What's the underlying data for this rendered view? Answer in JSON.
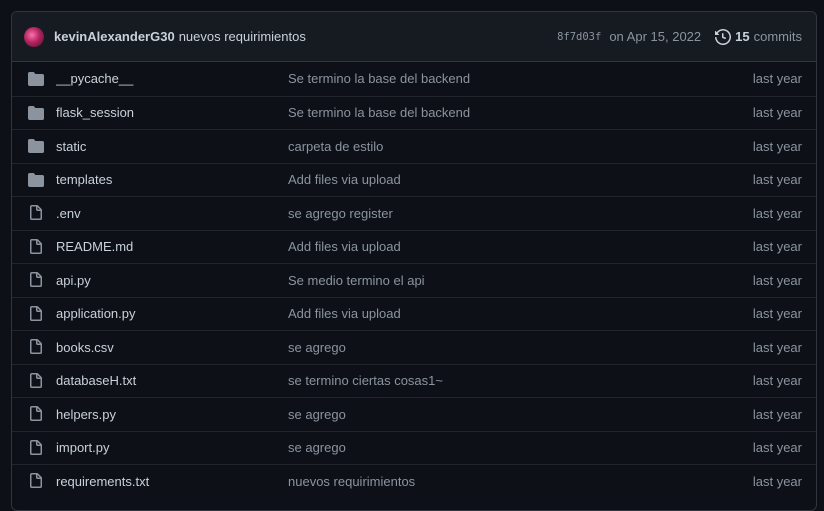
{
  "commit": {
    "author": "kevinAlexanderG30",
    "message": "nuevos requirimientos",
    "sha": "8f7d03f",
    "date": "on Apr 15, 2022",
    "count": "15",
    "count_label": "commits"
  },
  "files": [
    {
      "type": "folder",
      "name": "__pycache__",
      "message": "Se termino la base del backend",
      "age": "last year"
    },
    {
      "type": "folder",
      "name": "flask_session",
      "message": "Se termino la base del backend",
      "age": "last year"
    },
    {
      "type": "folder",
      "name": "static",
      "message": "carpeta de estilo",
      "age": "last year"
    },
    {
      "type": "folder",
      "name": "templates",
      "message": "Add files via upload",
      "age": "last year"
    },
    {
      "type": "file",
      "name": ".env",
      "message": "se agrego register",
      "age": "last year"
    },
    {
      "type": "file",
      "name": "README.md",
      "message": "Add files via upload",
      "age": "last year"
    },
    {
      "type": "file",
      "name": "api.py",
      "message": "Se medio termino el api",
      "age": "last year"
    },
    {
      "type": "file",
      "name": "application.py",
      "message": "Add files via upload",
      "age": "last year"
    },
    {
      "type": "file",
      "name": "books.csv",
      "message": "se agrego",
      "age": "last year"
    },
    {
      "type": "file",
      "name": "databaseH.txt",
      "message": "se termino ciertas cosas1~",
      "age": "last year"
    },
    {
      "type": "file",
      "name": "helpers.py",
      "message": "se agrego",
      "age": "last year"
    },
    {
      "type": "file",
      "name": "import.py",
      "message": "se agrego",
      "age": "last year"
    },
    {
      "type": "file",
      "name": "requirements.txt",
      "message": "nuevos requirimientos",
      "age": "last year"
    }
  ],
  "colors": {
    "background": "#0d1117",
    "header": "#161b22",
    "border": "#30363d",
    "text": "#c9d1d9",
    "muted": "#8b949e",
    "icon": "#8b949e"
  },
  "icons": {
    "folder": "folder-icon",
    "file": "file-icon",
    "history": "history-icon"
  }
}
